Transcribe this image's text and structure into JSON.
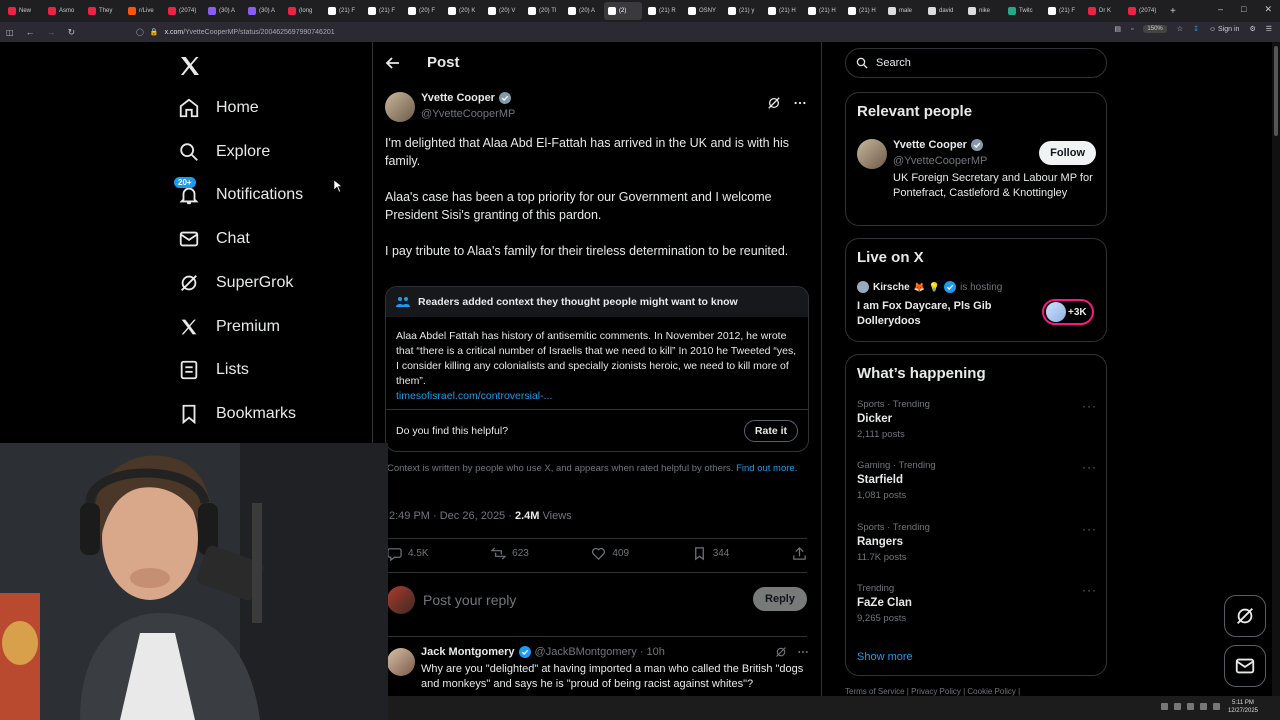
{
  "browser": {
    "tabs": [
      {
        "label": "New",
        "color": "#e24"
      },
      {
        "label": "Asmo",
        "color": "#e24"
      },
      {
        "label": "They",
        "color": "#e24"
      },
      {
        "label": "r/Live",
        "color": "#f50"
      },
      {
        "label": "(2074)",
        "color": "#e24"
      },
      {
        "label": "(30) A",
        "color": "#8a5cf6"
      },
      {
        "label": "(30) A",
        "color": "#8a5cf6"
      },
      {
        "label": "(long",
        "color": "#e24"
      },
      {
        "label": "(21) F",
        "color": "#fff"
      },
      {
        "label": "(21) F",
        "color": "#fff"
      },
      {
        "label": "(20) F",
        "color": "#fff"
      },
      {
        "label": "(20) K",
        "color": "#fff"
      },
      {
        "label": "(20) V",
        "color": "#fff"
      },
      {
        "label": "(20) Tl",
        "color": "#fff"
      },
      {
        "label": "(20) A",
        "color": "#fff"
      },
      {
        "label": "(2)",
        "color": "#fff"
      },
      {
        "label": "(21) R",
        "color": "#fff"
      },
      {
        "label": "OSNY",
        "color": "#fff"
      },
      {
        "label": "(21) y",
        "color": "#fff"
      },
      {
        "label": "(21) H",
        "color": "#fff"
      },
      {
        "label": "(21) H",
        "color": "#fff"
      },
      {
        "label": "(21) H",
        "color": "#fff"
      },
      {
        "label": "male",
        "color": "#ddd"
      },
      {
        "label": "david",
        "color": "#ddd"
      },
      {
        "label": "nike",
        "color": "#ddd"
      },
      {
        "label": "Twitc",
        "color": "#2a8"
      },
      {
        "label": "(21) F",
        "color": "#fff"
      },
      {
        "label": "Dr K",
        "color": "#e24"
      },
      {
        "label": "(2074)",
        "color": "#e24"
      }
    ],
    "active_tab_index": 15,
    "url_host": "x.com",
    "url_path": "/YvetteCooperMP/status/2004625697990746201",
    "zoom": "150%",
    "sign_in": "Sign in"
  },
  "nav": {
    "items": [
      {
        "label": "Home",
        "icon": "home-icon"
      },
      {
        "label": "Explore",
        "icon": "search-icon"
      },
      {
        "label": "Notifications",
        "icon": "bell-icon",
        "badge": "20+"
      },
      {
        "label": "Chat",
        "icon": "mail-icon"
      },
      {
        "label": "SuperGrok",
        "icon": "grok-icon"
      },
      {
        "label": "Premium",
        "icon": "x-logo-icon"
      },
      {
        "label": "Lists",
        "icon": "list-icon"
      },
      {
        "label": "Bookmarks",
        "icon": "bookmark-icon"
      }
    ]
  },
  "post": {
    "header_title": "Post",
    "author_name": "Yvette Cooper",
    "author_handle": "@YvetteCooperMP",
    "paragraphs": [
      "I'm delighted that Alaa Abd El-Fattah has arrived in the UK and is with his family.",
      "Alaa's case has been a top priority for our Government and I welcome President Sisi's granting of this pardon.",
      "I pay tribute to Alaa's family for their tireless determination to be reunited."
    ],
    "note": {
      "header": "Readers added context they thought people might want to know",
      "text": "Alaa Abdel Fattah has history of antisemitic comments. In November 2012, he wrote that “there is a critical number of Israelis that we need to kill” In 2010 he Tweeted “yes, I consider killing any colonialists and specially zionists heroic, we need to kill more of them”.",
      "link": "timesofisrael.com/controversial-...",
      "question": "Do you find this helpful?",
      "rate_label": "Rate it"
    },
    "context_text": "Context is written by people who use X, and appears when rated helpful by others.",
    "context_link": "Find out more.",
    "timestamp": "2:49 PM · Dec 26, 2025 ·",
    "views_count": "2.4M",
    "views_label": "Views",
    "stats": {
      "replies": "4.5K",
      "reposts": "623",
      "likes": "409",
      "bookmarks": "344"
    },
    "reply_placeholder": "Post your reply",
    "reply_button": "Reply"
  },
  "comment": {
    "name": "Jack Montgomery",
    "handle": "@JackBMontgomery · 10h",
    "text": "Why are you \"delighted\" at having imported a man who called the British \"dogs and monkeys\" and says he is \"proud of being racist against whites\"?"
  },
  "sidebar": {
    "search_placeholder": "Search",
    "relevant_title": "Relevant people",
    "relevant": {
      "name": "Yvette Cooper",
      "handle": "@YvetteCooperMP",
      "bio": "UK Foreign Secretary and Labour MP for Pontefract, Castleford & Knottingley",
      "follow": "Follow"
    },
    "live_title": "Live on X",
    "live": {
      "host": "Kirsche",
      "hosting": "is hosting",
      "title": "I am Fox Daycare, Pls Gib Dollerydoos",
      "count": "+3K"
    },
    "happening_title": "What’s happening",
    "trends": [
      {
        "context": "Sports · Trending",
        "name": "Dicker",
        "posts": "2,111 posts"
      },
      {
        "context": "Gaming · Trending",
        "name": "Starfield",
        "posts": "1,081 posts"
      },
      {
        "context": "Sports · Trending",
        "name": "Rangers",
        "posts": "11.7K posts"
      },
      {
        "context": "Trending",
        "name": "FaZe Clan",
        "posts": "9,265 posts"
      }
    ],
    "show_more": "Show more",
    "footer": "Terms of Service  |  Privacy Policy  |  Cookie Policy  |"
  },
  "taskbar": {
    "time": "5:11 PM",
    "date": "12/27/2025"
  },
  "colors": {
    "accent": "#1d9bf0",
    "live": "#f91880",
    "border": "#2f3336",
    "muted": "#71767b"
  }
}
